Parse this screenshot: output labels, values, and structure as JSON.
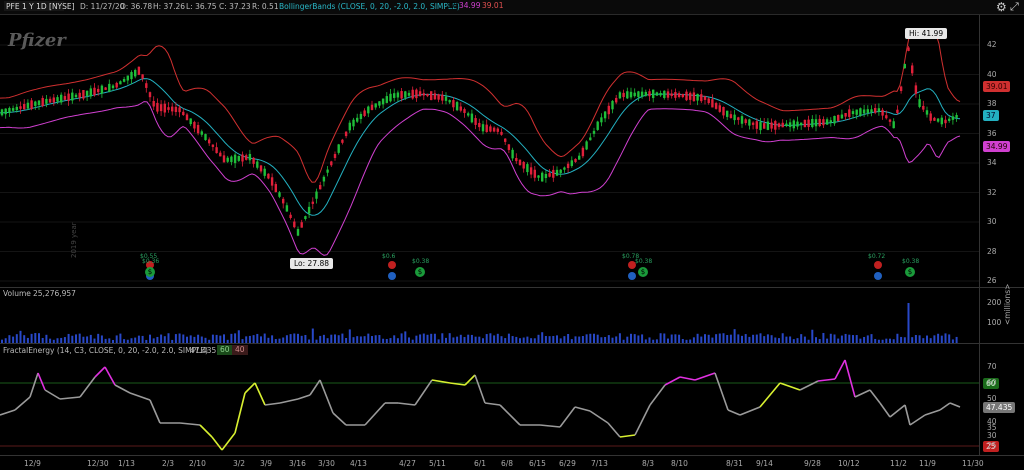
{
  "header": {
    "symbol": "PFE 1 Y 1D [NYSE]",
    "date": "D: 11/27/20",
    "open": "O: 36.78",
    "high": "H: 37.26",
    "low": "L: 36.75",
    "close": "C: 37.23",
    "range": "R: 0.51",
    "study": "BollingerBands (CLOSE, 0, 20, -2.0, 2.0, SIMPLE)",
    "mid_value": "37",
    "lower_value": "34.99",
    "upper_value": "39.01"
  },
  "logo_text": "Pfizer",
  "watermark": "2019 year",
  "price_axis": [
    "42",
    "40",
    "38",
    "36",
    "34",
    "32",
    "30",
    "28",
    "26"
  ],
  "price_tags": {
    "upper": "39.01",
    "mid": "37",
    "lower": "34.99"
  },
  "hi_label": "Hi: 41.99",
  "lo_label": "Lo: 27.88",
  "dividend_labels": [
    "$0.36",
    "$0.38",
    "$0.38",
    "$0.38"
  ],
  "earnings_labels": [
    "$0.55",
    "$0.6",
    "$0.78",
    "$0.72"
  ],
  "volume": {
    "title": "Volume",
    "value": "25,276,957",
    "axis": [
      "200",
      "100"
    ],
    "unit": "<millions>"
  },
  "fractal": {
    "title": "FractalEnergy (14, C3, CLOSE, 0, 20, -2.0, 2.0, SIMPLE)",
    "value": "47.435",
    "chip1": "60",
    "chip2": "40",
    "axis": [
      "70",
      "60",
      "50",
      "40",
      "35",
      "30",
      "25"
    ],
    "tags": {
      "upper": "60",
      "value": "47.435",
      "lower": "25"
    }
  },
  "x_axis": [
    "12/9",
    "12/30",
    "1/13",
    "2/3",
    "2/10",
    "3/2",
    "3/9",
    "3/16",
    "3/30",
    "4/13",
    "4/27",
    "5/11",
    "6/1",
    "6/8",
    "6/15",
    "6/29",
    "7/13",
    "8/3",
    "8/10",
    "8/31",
    "9/14",
    "9/28",
    "10/12",
    "11/2",
    "11/9",
    "11/30"
  ],
  "colors": {
    "up": "#1fbf3a",
    "down": "#e0203a",
    "mid": "#23b0c0",
    "upper": "#d03030",
    "lower": "#d040d0",
    "fe_gray": "#9a9a9a",
    "fe_yellow": "#d8f030",
    "fe_magenta": "#e030e0",
    "volume": "#2848c8"
  }
}
